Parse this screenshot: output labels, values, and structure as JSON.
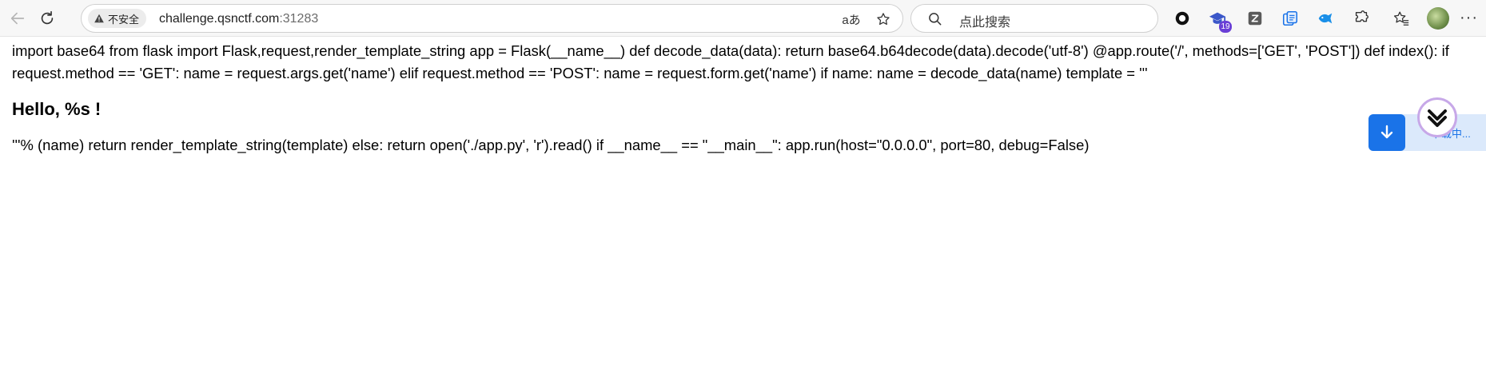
{
  "browser": {
    "security_label": "不安全",
    "url_host": "challenge.qsnctf.com",
    "url_port": ":31283",
    "read_aloud": "aあ",
    "search_placeholder": "点此搜索",
    "extension_badge_count": "19"
  },
  "page": {
    "line1": "import base64 from flask import Flask,request,render_template_string app = Flask(__name__) def decode_data(data): return base64.b64decode(data).decode('utf-8') @app.route('/', methods=['GET', 'POST']) def index(): if request.method == 'GET': name = request.args.get('name') elif request.method == 'POST': name = request.form.get('name') if name: name = decode_data(name) template = '''",
    "heading": "Hello, %s !",
    "line2": "'''% (name) return render_template_string(template) else: return open('./app.py', 'r').read() if __name__ == \"__main__\": app.run(host=\"0.0.0.0\", port=80, debug=False)"
  },
  "widget": {
    "label": "下载中..."
  },
  "colors": {
    "accent": "#1a73e8",
    "badge": "#6a3fd6"
  }
}
